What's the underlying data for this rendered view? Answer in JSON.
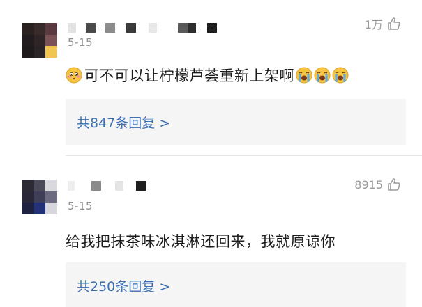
{
  "comments": [
    {
      "date": "5-15",
      "likes": "1万",
      "text": "可不可以让柠檬芦荟重新上架啊",
      "replies_label": "共847条回复 >"
    },
    {
      "date": "5-15",
      "likes": "8915",
      "text": "给我把抹茶味冰淇淋还回来，我就原谅你",
      "replies_label": "共250条回复 >"
    }
  ],
  "icons": {
    "like": "thumbs-up-outline-icon",
    "emoji_shy": "shy-face-emoji",
    "emoji_cry": "loudly-crying-face-emoji"
  },
  "colors": {
    "reply_link": "#3b6fb2",
    "reply_bg": "#f5f5f5",
    "meta_text": "#8e8e8e"
  }
}
